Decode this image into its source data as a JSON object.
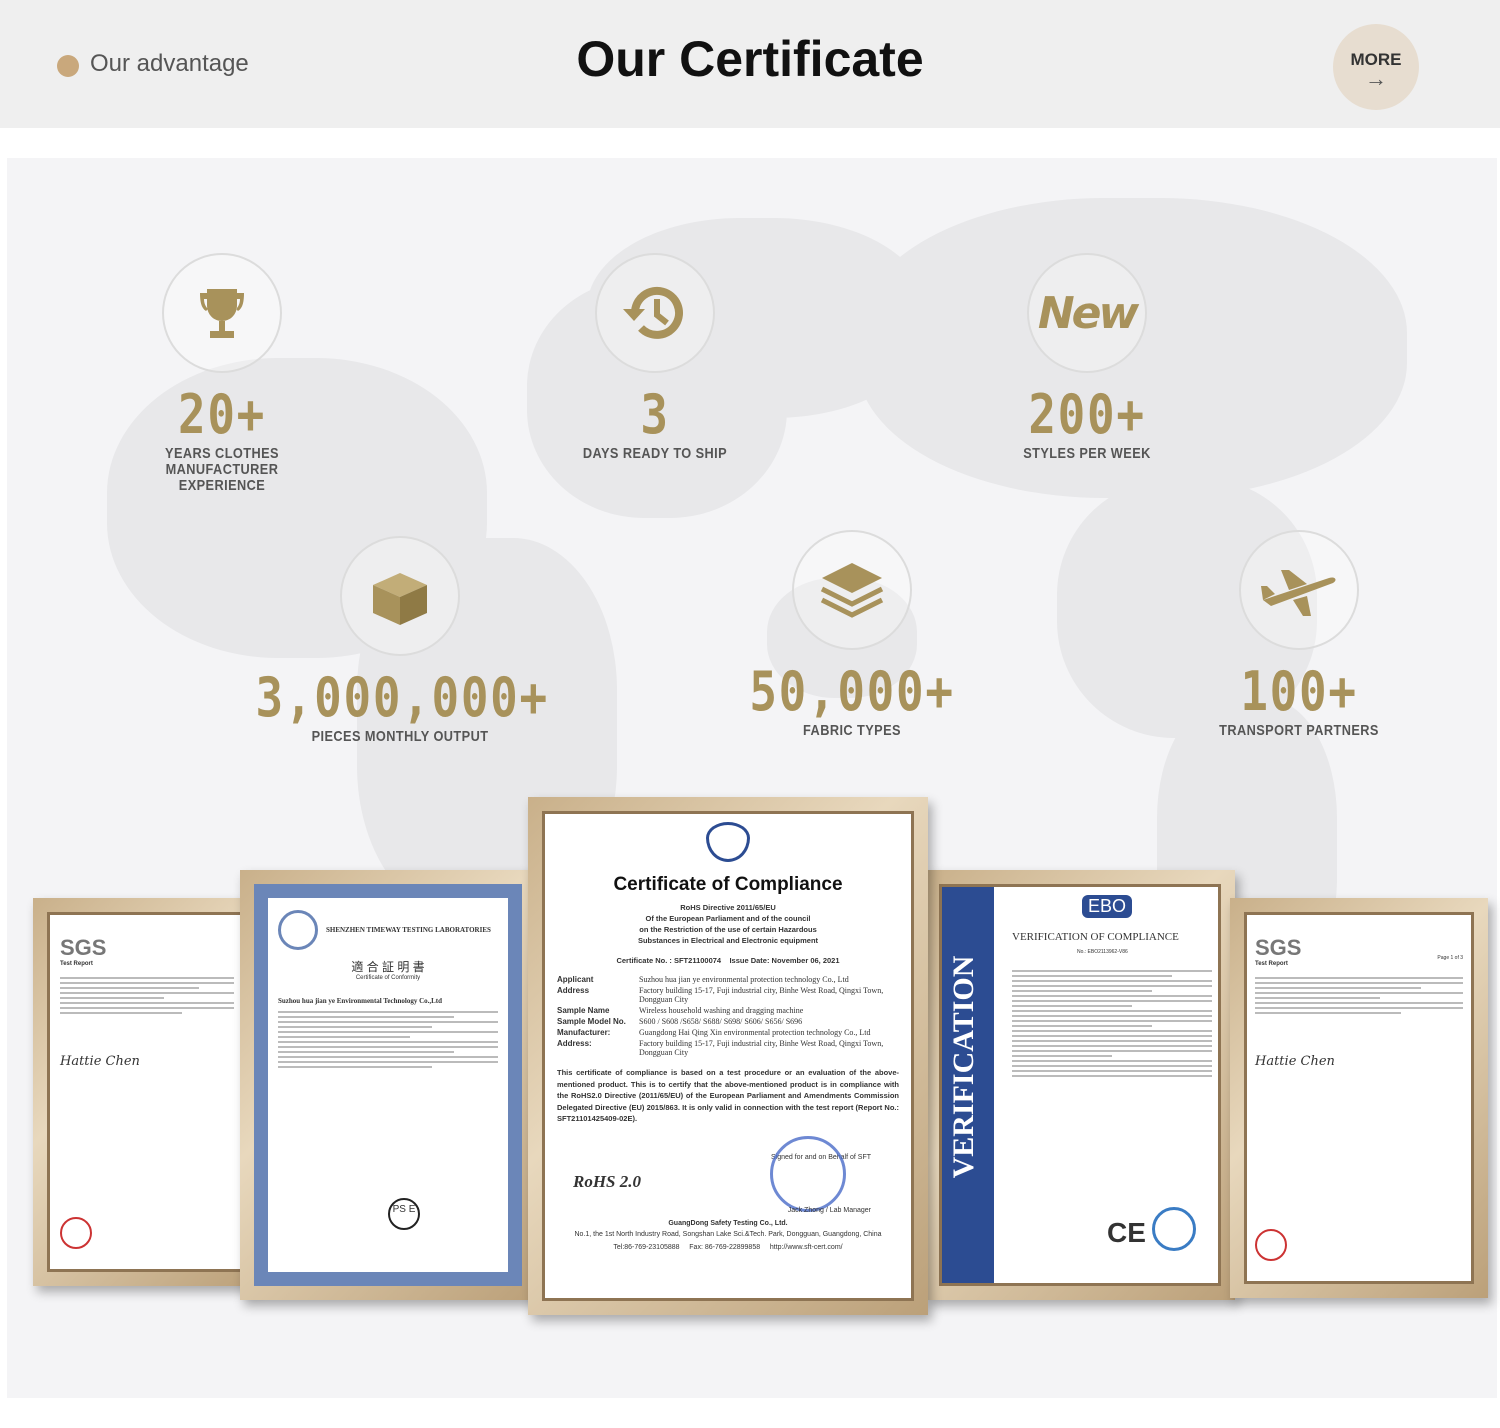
{
  "header": {
    "section_label": "Our advantage",
    "title": "Our Certificate",
    "more_label": "MORE",
    "more_arrow": "→"
  },
  "stats": [
    {
      "icon": "trophy-icon",
      "value": "20+",
      "label": "YEARS CLOTHES MANUFACTURER EXPERIENCE"
    },
    {
      "icon": "clock-icon",
      "value": "3",
      "label": "DAYS READY TO SHIP"
    },
    {
      "icon": "new-icon",
      "icon_text": "New",
      "value": "200+",
      "label": "STYLES PER WEEK"
    },
    {
      "icon": "box-icon",
      "value": "3,000,000+",
      "label": "PIECES MONTHLY OUTPUT"
    },
    {
      "icon": "layers-icon",
      "value": "50,000+",
      "label": "FABRIC TYPES"
    },
    {
      "icon": "airplane-icon",
      "value": "100+",
      "label": "TRANSPORT PARTNERS"
    }
  ],
  "certificates": {
    "sgs_left": {
      "logo": "SGS",
      "heading": "Test Report",
      "signature": "Hattie Chen"
    },
    "timeway": {
      "lab": "SHENZHEN TIMEWAY TESTING LABORATORIES",
      "title": "適 合 証 明 書",
      "subtitle": "Certificate of Conformity",
      "applicant": "Suzhou hua jian ye Environmental Technology Co.,Ltd",
      "mark": "PS E"
    },
    "rohs": {
      "title": "Certificate of Compliance",
      "directive": [
        "RoHS Directive 2011/65/EU",
        "Of the European Parliament and of the council",
        "on the Restriction of the use of certain Hazardous",
        "Substances in Electrical and Electronic equipment"
      ],
      "cert_no": "Certificate No. : SFT21100074",
      "issue_date": "Issue Date: November 06, 2021",
      "fields": [
        {
          "k": "Applicant",
          "v": "Suzhou hua jian ye environmental protection technology Co., Ltd"
        },
        {
          "k": "Address",
          "v": "Factory building 15-17, Fuji industrial city, Binhe West Road, Qingxi Town, Dongguan City"
        },
        {
          "k": "Sample Name",
          "v": "Wireless household washing and dragging machine"
        },
        {
          "k": "Sample Model No.",
          "v": "S600 / S608 /S658/ S688/ S698/ S606/ S656/ S696"
        },
        {
          "k": "Manufacturer:",
          "v": "Guangdong Hai Qing Xin environmental protection technology Co., Ltd"
        },
        {
          "k": "Address:",
          "v": "Factory building 15-17, Fuji industrial city, Binhe West Road, Qingxi Town, Dongguan City"
        }
      ],
      "statement": "This certificate of compliance is based on a test procedure or an evaluation of the above-mentioned product. This is to certify that the above-mentioned product is in compliance with the RoHS2.0 Directive (2011/65/EU) of the European Parliament and Amendments Commission Delegated Directive (EU) 2015/863. It is only valid in connection with the test report (Report No.: SFT21101425409-02E).",
      "signed": "Signed for and on Behalf of SFT",
      "rohs_mark": "RoHS 2.0",
      "signer": "Jack Zhong / Lab Manager",
      "company": "GuangDong Safety Testing Co., Ltd.",
      "address": "No.1, the 1st North Industry Road, Songshan Lake Sci.&Tech. Park, Dongguan, Guangdong, China",
      "tel": "Tel:86-769-23105888",
      "fax": "Fax: 86-769-22899858",
      "web": "http://www.sft-cert.com/"
    },
    "ebo": {
      "side": "VERIFICATION",
      "logo": "EBO",
      "title": "VERIFICATION OF COMPLIANCE",
      "no": "No.: EBO2113962-V86",
      "ce": "CE"
    },
    "sgs_right": {
      "logo": "SGS",
      "heading": "Test Report",
      "signature": "Hattie Chen",
      "page": "Page 1 of 3"
    }
  }
}
